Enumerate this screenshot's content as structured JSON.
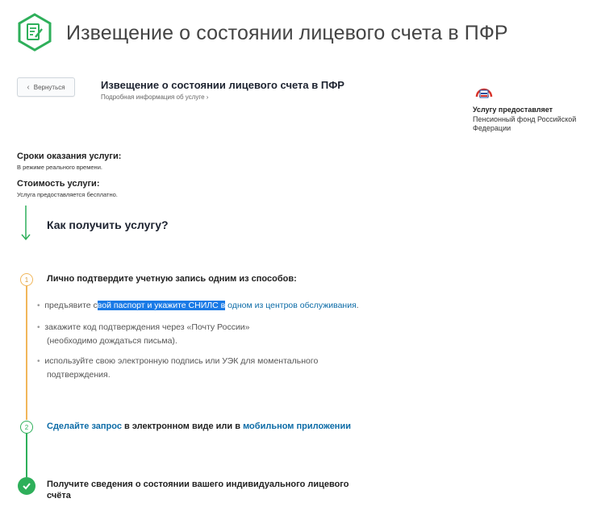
{
  "header": {
    "title": "Извещение о состоянии лицевого счета в ПФР"
  },
  "back_button": {
    "label": "Вернуться"
  },
  "service": {
    "title": "Извещение о состоянии лицевого счета в ПФР",
    "details_link": "Подробная информация об услуге"
  },
  "provider": {
    "label": "Услугу предоставляет",
    "name": "Пенсионный фонд Российской Федерации"
  },
  "terms": {
    "title": "Сроки оказания услуги:",
    "value": "В режиме реального времени."
  },
  "cost": {
    "title": "Стоимость услуги:",
    "value": "Услуга предоставляется бесплатно."
  },
  "how_title": "Как получить услугу?",
  "step1": {
    "number": "1",
    "title": "Лично подтвердите учетную запись одним из способов:",
    "bullets": [
      {
        "pre": "предъявите с",
        "highlight": "вой паспорт и укажите СНИЛС в",
        "link": "одном из центров обслуживания",
        "post": "."
      },
      {
        "line1": "закажите код подтверждения через «Почту России»",
        "line2": "(необходимо дождаться письма)."
      },
      {
        "line1": "используйте свою электронную подпись или УЭК для моментального",
        "line2": "подтверждения."
      }
    ]
  },
  "step2": {
    "number": "2",
    "link1": "Сделайте запрос",
    "middle": " в электронном виде или в ",
    "link2": "мобильном приложении"
  },
  "step3": {
    "line1": "Получите сведения о состоянии вашего индивидуального лицевого",
    "line2": "счёта"
  },
  "colors": {
    "green": "#2eaf5a",
    "orange": "#f1b65a",
    "link": "#0d6ca7",
    "highlight": "#1a7ae6"
  }
}
